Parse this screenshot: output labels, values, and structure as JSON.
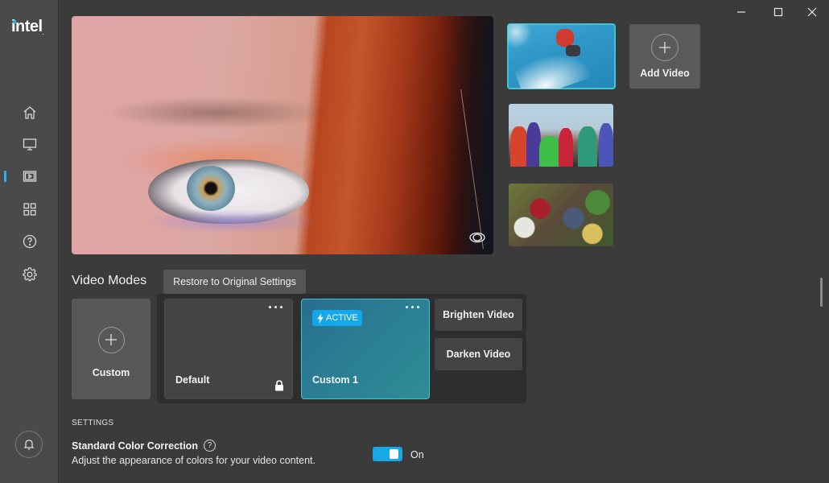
{
  "app": {
    "logo_text": "intel",
    "logo_mark": "."
  },
  "window_controls": {
    "minimize": "minimize-icon",
    "maximize": "maximize-icon",
    "close": "close-icon"
  },
  "sidebar": {
    "items": [
      {
        "id": "home",
        "icon": "home-icon",
        "active": false
      },
      {
        "id": "display",
        "icon": "monitor-icon",
        "active": false
      },
      {
        "id": "video",
        "icon": "video-icon",
        "active": true
      },
      {
        "id": "apps",
        "icon": "grid-icon",
        "active": false
      },
      {
        "id": "help",
        "icon": "help-icon",
        "active": false
      },
      {
        "id": "settings",
        "icon": "gear-icon",
        "active": false
      }
    ],
    "notifications_icon": "bell-icon",
    "accent_color": "#2bb4e5"
  },
  "preview": {
    "description": "Close-up eye with red hair video preview",
    "compare_icon": "eye-icon"
  },
  "thumbnails": [
    {
      "subject": "Snowboarder jump",
      "selected": true
    },
    {
      "subject": "Group of people smiling",
      "selected": false
    },
    {
      "subject": "Market vegetables",
      "selected": false
    }
  ],
  "add_video": {
    "label": "Add Video"
  },
  "video_modes": {
    "title": "Video Modes",
    "restore_label": "Restore to Original Settings",
    "custom_add_label": "Custom",
    "modes": [
      {
        "name": "Default",
        "locked": true,
        "active": false
      },
      {
        "name": "Custom 1",
        "locked": false,
        "active": true,
        "badge": "ACTIVE"
      }
    ],
    "presets": [
      "Brighten Video",
      "Darken Video"
    ]
  },
  "settings": {
    "section_label": "SETTINGS",
    "items": [
      {
        "title": "Standard Color Correction",
        "description": "Adjust the appearance of colors for your video content.",
        "help": "?",
        "toggle_on": true,
        "toggle_label": "On"
      }
    ]
  },
  "colors": {
    "accent": "#14a8ea",
    "active_border": "#3cc6d8",
    "background": "#3b3b3b",
    "sidebar": "#4a4a4a"
  }
}
